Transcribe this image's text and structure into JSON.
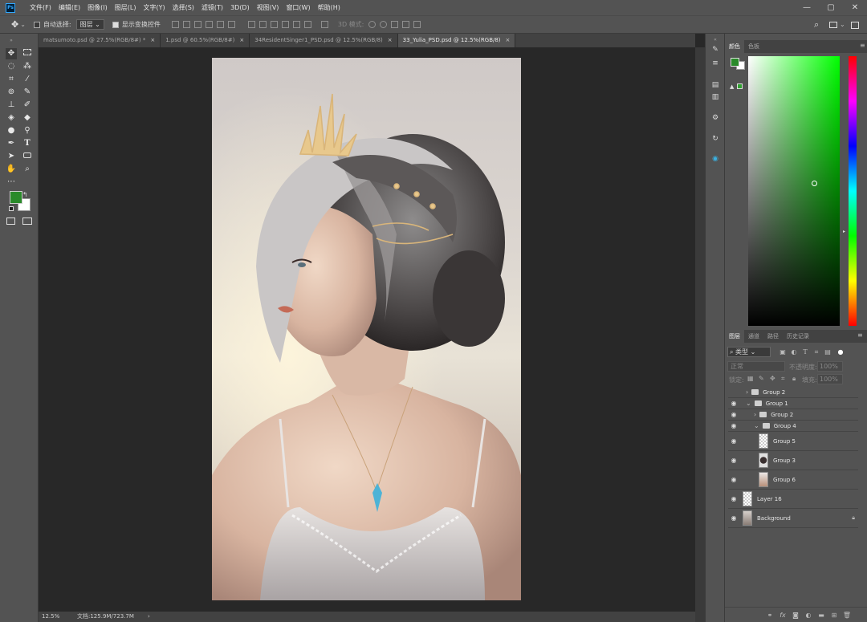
{
  "app": {
    "logo_text": "Ps"
  },
  "menu": [
    "文件(F)",
    "编辑(E)",
    "图像(I)",
    "图层(L)",
    "文字(Y)",
    "选择(S)",
    "滤镜(T)",
    "3D(D)",
    "视图(V)",
    "窗口(W)",
    "帮助(H)"
  ],
  "window_controls": {
    "minimize": "—",
    "maximize": "▢",
    "close": "✕"
  },
  "options_bar": {
    "auto_select_label": "自动选择:",
    "auto_select_checked": false,
    "auto_select_target": "图层",
    "show_transform_label": "显示变换控件",
    "show_transform_checked": true,
    "mode_3d_label": "3D 模式:"
  },
  "tabs": [
    {
      "label": "matsumoto.psd @ 27.5%(RGB/8#) *",
      "close": "×",
      "active": false
    },
    {
      "label": "1.psd @ 60.5%(RGB/8#)",
      "close": "×",
      "active": false
    },
    {
      "label": "34ResidentSinger1_PSD.psd @ 12.5%(RGB/8)",
      "close": "×",
      "active": false
    },
    {
      "label": "33_Yulia_PSD.psd @ 12.5%(RGB/8)",
      "close": "×",
      "active": true
    }
  ],
  "status_bar": {
    "zoom": "12.5%",
    "doc_info": "文档:125.9M/723.7M",
    "arrow": "›"
  },
  "colors": {
    "foreground": "#2a8a2a",
    "background": "#ffffff",
    "picker_hue": "#00ff00"
  },
  "color_panel": {
    "tabs": [
      "颜色",
      "色板"
    ],
    "active": 0
  },
  "layers_panel": {
    "tabs": [
      "图层",
      "通道",
      "路径",
      "历史记录"
    ],
    "active": 0,
    "filter_label": "类型",
    "blend_mode": "正常",
    "opacity_label": "不透明度:",
    "opacity_value": "100%",
    "lock_label": "锁定:",
    "fill_label": "填充:",
    "fill_value": "100%",
    "layers": [
      {
        "name": "Group 2",
        "type": "group",
        "indent": 0,
        "visible": false,
        "expanded": false
      },
      {
        "name": "Group 1",
        "type": "group",
        "indent": 0,
        "visible": true,
        "expanded": true
      },
      {
        "name": "Group 2",
        "type": "group",
        "indent": 1,
        "visible": true,
        "expanded": false
      },
      {
        "name": "Group 4",
        "type": "group",
        "indent": 1,
        "visible": true,
        "expanded": true
      },
      {
        "name": "Group 5",
        "type": "layer",
        "indent": 2,
        "visible": true,
        "thumb": "checker"
      },
      {
        "name": "Group 3",
        "type": "layer",
        "indent": 2,
        "visible": true,
        "thumb": "dark"
      },
      {
        "name": "Group 6",
        "type": "layer",
        "indent": 2,
        "visible": true,
        "thumb": "skin"
      },
      {
        "name": "Layer 16",
        "type": "layer",
        "indent": 0,
        "visible": true,
        "thumb": "checker"
      },
      {
        "name": "Background",
        "type": "layer",
        "indent": 0,
        "visible": true,
        "thumb": "photo",
        "locked": true
      }
    ]
  }
}
